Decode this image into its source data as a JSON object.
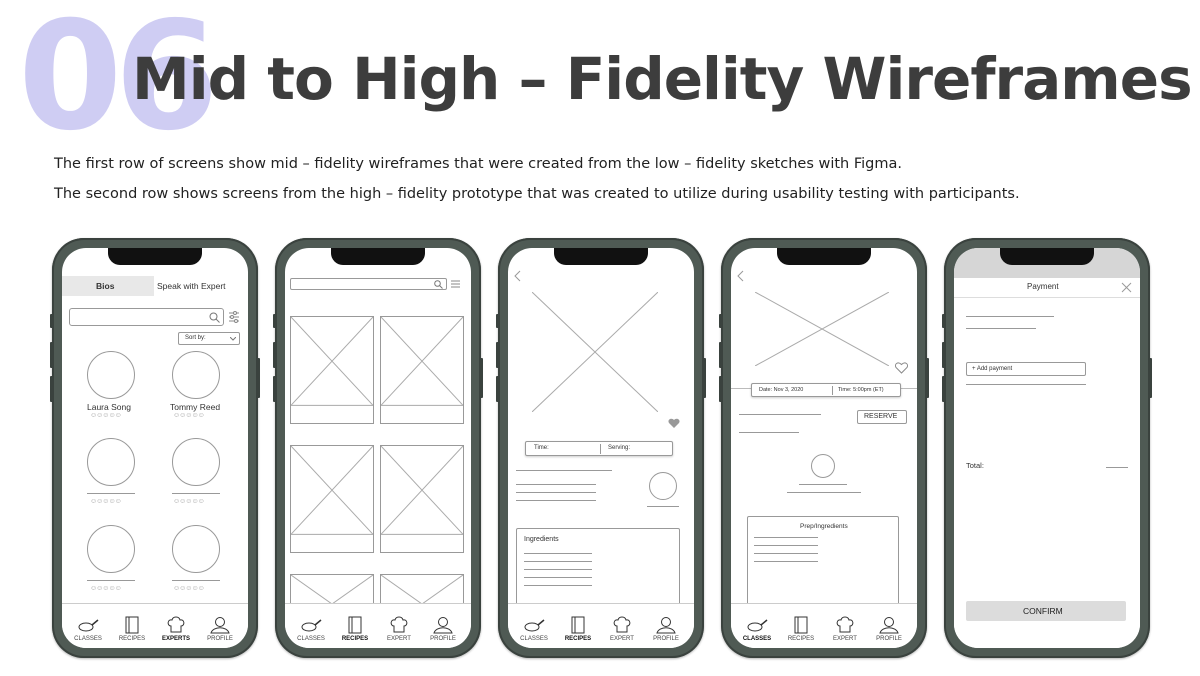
{
  "header": {
    "number": "06",
    "title": "Mid to High – Fidelity Wireframes",
    "line1": "The first row of screens show mid – fidelity wireframes that were created from the low – fidelity sketches with Figma.",
    "line2": "The second row shows screens from the high – fidelity prototype that was created to utilize during usability testing with participants."
  },
  "tabs": {
    "classes": "CLASSES",
    "recipes": "RECIPES",
    "experts": "EXPERTS",
    "expert": "EXPERT",
    "profile": "PROFILE"
  },
  "phone1": {
    "tab_bios": "Bios",
    "tab_speak": "Speak with Expert",
    "sort_label": "Sort by:",
    "expert1": "Laura Song",
    "expert2": "Tommy Reed",
    "active_tab": "EXPERTS"
  },
  "phone2": {
    "active_tab": "RECIPES"
  },
  "phone3": {
    "time_label": "Time:",
    "serving_label": "Serving:",
    "ingredients_title": "Ingredients",
    "active_tab": "RECIPES"
  },
  "phone4": {
    "date_label": "Date: Nov 3, 2020",
    "time_label": "Time: 5:00pm (ET)",
    "reserve_label": "RESERVE",
    "prep_title": "Prep/Ingredients",
    "active_tab": "CLASSES"
  },
  "phone5": {
    "title": "Payment",
    "add_payment": "+ Add payment",
    "total_label": "Total:",
    "confirm_label": "CONFIRM"
  }
}
